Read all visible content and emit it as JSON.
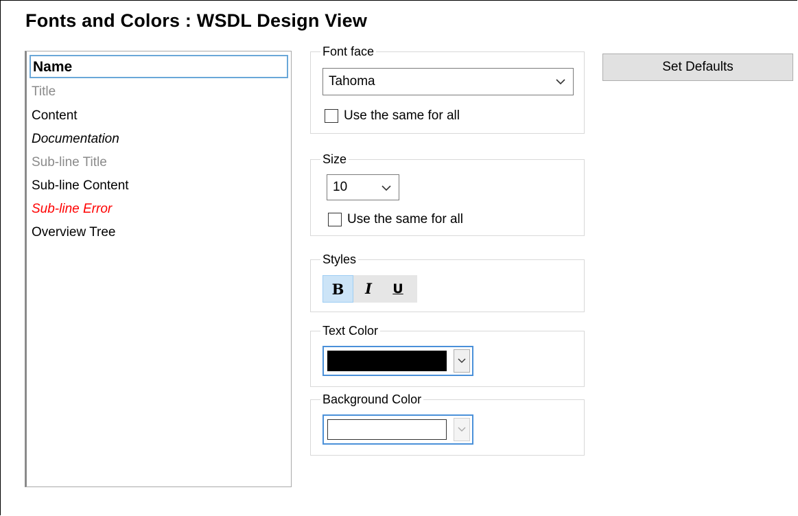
{
  "title": "Fonts and Colors : WSDL Design View",
  "list": {
    "items": [
      {
        "label": "Name",
        "color": "#000000",
        "style": "bold",
        "selected": true
      },
      {
        "label": "Title",
        "color": "#8a8a8a",
        "style": "normal"
      },
      {
        "label": "Content",
        "color": "#000000",
        "style": "normal"
      },
      {
        "label": "Documentation",
        "color": "#000000",
        "style": "italic"
      },
      {
        "label": "Sub-line Title",
        "color": "#8a8a8a",
        "style": "normal"
      },
      {
        "label": "Sub-line Content",
        "color": "#000000",
        "style": "normal"
      },
      {
        "label": "Sub-line Error",
        "color": "#ff0000",
        "style": "italic"
      },
      {
        "label": "Overview Tree",
        "color": "#000000",
        "style": "normal"
      }
    ]
  },
  "font_face": {
    "label": "Font face",
    "value": "Tahoma",
    "same_for_all": "Use the same for all",
    "same_for_all_checked": false
  },
  "size": {
    "label": "Size",
    "value": "10",
    "same_for_all": "Use the same for all",
    "same_for_all_checked": false
  },
  "styles": {
    "label": "Styles",
    "bold": "B",
    "italic": "I",
    "underline": "U",
    "bold_active": true
  },
  "text_color": {
    "label": "Text Color",
    "color": "#000000"
  },
  "background_color": {
    "label": "Background Color",
    "color": "#ffffff"
  },
  "set_defaults_label": "Set Defaults",
  "icons": {
    "dropdown": "chevron-down-icon"
  }
}
